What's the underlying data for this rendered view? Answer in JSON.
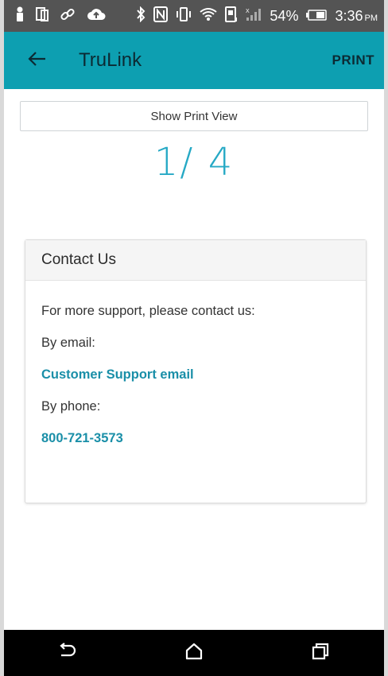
{
  "status_bar": {
    "battery_percent": "54%",
    "time": "3:36",
    "ampm": "PM",
    "icons": [
      "person-icon",
      "sim-icon",
      "link-icon",
      "cloud-icon",
      "bluetooth-icon",
      "nfc-icon",
      "vibrate-icon",
      "wifi-icon",
      "phone-screen-icon",
      "signal-icon",
      "battery-icon"
    ]
  },
  "app_bar": {
    "title": "TruLink",
    "print_label": "PRINT",
    "back_icon": "back-arrow-icon",
    "color": "#0d9fb1"
  },
  "content": {
    "print_view_button": "Show Print View",
    "page_indicator": "1/ 4"
  },
  "card": {
    "title": "Contact Us",
    "intro": "For more support, please contact us:",
    "email_label": "By email:",
    "email_link": "Customer Support email",
    "phone_label": "By phone:",
    "phone_link": "800-721-3573",
    "link_color": "#1a8fa8"
  },
  "nav_bar": {
    "icons": [
      "back-nav-icon",
      "home-nav-icon",
      "recents-nav-icon"
    ]
  }
}
